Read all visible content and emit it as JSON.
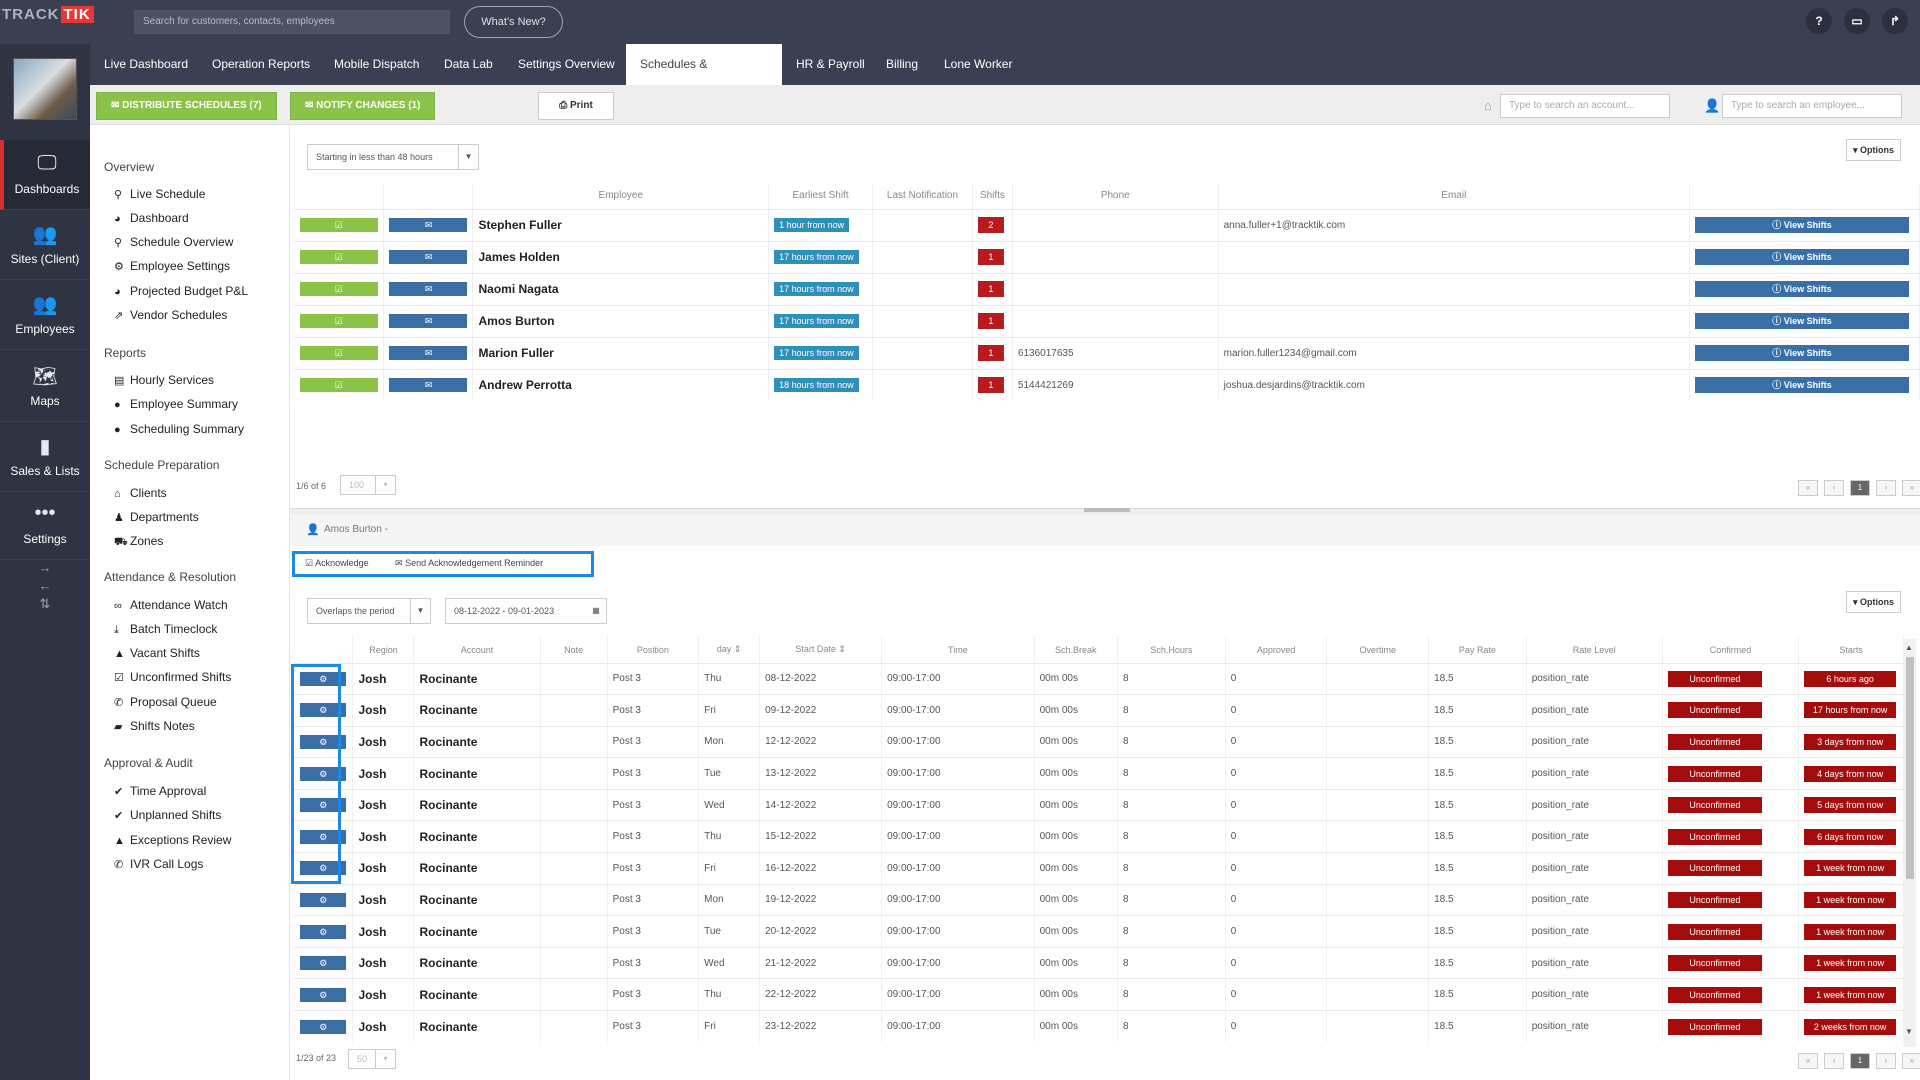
{
  "topbar": {
    "logo_a": "TRACK",
    "logo_b": "TIK",
    "search_placeholder": "Search for customers, contacts, employees",
    "whats_new": "What's New?"
  },
  "nav_tabs": [
    "Live Dashboard",
    "Operation Reports",
    "Mobile Dispatch",
    "Data Lab",
    "Settings Overview",
    "Schedules & Attendance",
    "HR & Payroll",
    "Billing",
    "Lone Worker"
  ],
  "left_nav": [
    "Dashboards",
    "Sites (Client)",
    "Employees",
    "Maps",
    "Sales & Lists",
    "Settings"
  ],
  "toolbar": {
    "distribute": "DISTRIBUTE SCHEDULES (7)",
    "notify": "NOTIFY CHANGES (1)",
    "print": "Print",
    "account_search": "Type to search an account...",
    "employee_search": "Type to search an employee..."
  },
  "sidemenu": {
    "sections": [
      {
        "title": "Overview",
        "items": [
          "Live Schedule",
          "Dashboard",
          "Schedule Overview",
          "Employee Settings",
          "Projected Budget P&L",
          "Vendor Schedules"
        ]
      },
      {
        "title": "Reports",
        "items": [
          "Hourly Services",
          "Employee Summary",
          "Scheduling Summary"
        ]
      },
      {
        "title": "Schedule Preparation",
        "items": [
          "Clients",
          "Departments",
          "Zones"
        ]
      },
      {
        "title": "Attendance & Resolution",
        "items": [
          "Attendance Watch",
          "Batch Timeclock",
          "Vacant Shifts",
          "Unconfirmed Shifts",
          "Proposal Queue",
          "Shifts Notes"
        ]
      },
      {
        "title": "Approval & Audit",
        "items": [
          "Time Approval",
          "Unplanned Shifts",
          "Exceptions Review",
          "IVR Call Logs"
        ]
      }
    ]
  },
  "top_panel": {
    "filter": "Starting in less than 48 hours",
    "options": "Options",
    "headers": [
      "Employee",
      "Earliest Shift",
      "Last Notification",
      "Shifts",
      "Phone",
      "Email"
    ],
    "rows": [
      {
        "employee": "Stephen Fuller",
        "earliest": "1 hour from now",
        "shifts": "2",
        "phone": "",
        "email": "anna.fuller+1@tracktik.com"
      },
      {
        "employee": "James Holden",
        "earliest": "17 hours from now",
        "shifts": "1",
        "phone": "",
        "email": ""
      },
      {
        "employee": "Naomi Nagata",
        "earliest": "17 hours from now",
        "shifts": "1",
        "phone": "",
        "email": ""
      },
      {
        "employee": "Amos Burton",
        "earliest": "17 hours from now",
        "shifts": "1",
        "phone": "",
        "email": ""
      },
      {
        "employee": "Marion Fuller",
        "earliest": "17 hours from now",
        "shifts": "1",
        "phone": "6136017635",
        "email": "marion.fuller1234@gmail.com"
      },
      {
        "employee": "Andrew Perrotta",
        "earliest": "18 hours from now",
        "shifts": "1",
        "phone": "5144421269",
        "email": "joshua.desjardins@tracktik.com"
      }
    ],
    "view_shifts": "View Shifts",
    "pager": "1/6 of 6",
    "page_size": "100",
    "page": "1"
  },
  "bottom_panel": {
    "employee_label": "Amos Burton -",
    "acknowledge": "Acknowledge",
    "send_reminder": "Send Acknowledgement Reminder",
    "period_filter": "Overlaps the period",
    "date_range": "08-12-2022 - 09-01-2023",
    "options": "Options",
    "headers": [
      "Region",
      "Account",
      "Note",
      "Position",
      "day",
      "Start Date",
      "Time",
      "Sch.Break",
      "Sch.Hours",
      "Approved",
      "Overtime",
      "Pay Rate",
      "Rate Level",
      "Confirmed",
      "Starts"
    ],
    "rows": [
      {
        "region": "Josh",
        "account": "Rocinante",
        "position": "Post 3",
        "day": "Thu",
        "date": "08-12-2022",
        "time": "09:00-17:00",
        "brk": "00m 00s",
        "hours": "8",
        "approved": "0",
        "pay": "18.5",
        "rate": "position_rate",
        "confirmed": "Unconfirmed",
        "starts": "6 hours ago"
      },
      {
        "region": "Josh",
        "account": "Rocinante",
        "position": "Post 3",
        "day": "Fri",
        "date": "09-12-2022",
        "time": "09:00-17:00",
        "brk": "00m 00s",
        "hours": "8",
        "approved": "0",
        "pay": "18.5",
        "rate": "position_rate",
        "confirmed": "Unconfirmed",
        "starts": "17 hours from now"
      },
      {
        "region": "Josh",
        "account": "Rocinante",
        "position": "Post 3",
        "day": "Mon",
        "date": "12-12-2022",
        "time": "09:00-17:00",
        "brk": "00m 00s",
        "hours": "8",
        "approved": "0",
        "pay": "18.5",
        "rate": "position_rate",
        "confirmed": "Unconfirmed",
        "starts": "3 days from now"
      },
      {
        "region": "Josh",
        "account": "Rocinante",
        "position": "Post 3",
        "day": "Tue",
        "date": "13-12-2022",
        "time": "09:00-17:00",
        "brk": "00m 00s",
        "hours": "8",
        "approved": "0",
        "pay": "18.5",
        "rate": "position_rate",
        "confirmed": "Unconfirmed",
        "starts": "4 days from now"
      },
      {
        "region": "Josh",
        "account": "Rocinante",
        "position": "Post 3",
        "day": "Wed",
        "date": "14-12-2022",
        "time": "09:00-17:00",
        "brk": "00m 00s",
        "hours": "8",
        "approved": "0",
        "pay": "18.5",
        "rate": "position_rate",
        "confirmed": "Unconfirmed",
        "starts": "5 days from now"
      },
      {
        "region": "Josh",
        "account": "Rocinante",
        "position": "Post 3",
        "day": "Thu",
        "date": "15-12-2022",
        "time": "09:00-17:00",
        "brk": "00m 00s",
        "hours": "8",
        "approved": "0",
        "pay": "18.5",
        "rate": "position_rate",
        "confirmed": "Unconfirmed",
        "starts": "6 days from now"
      },
      {
        "region": "Josh",
        "account": "Rocinante",
        "position": "Post 3",
        "day": "Fri",
        "date": "16-12-2022",
        "time": "09:00-17:00",
        "brk": "00m 00s",
        "hours": "8",
        "approved": "0",
        "pay": "18.5",
        "rate": "position_rate",
        "confirmed": "Unconfirmed",
        "starts": "1 week from now"
      },
      {
        "region": "Josh",
        "account": "Rocinante",
        "position": "Post 3",
        "day": "Mon",
        "date": "19-12-2022",
        "time": "09:00-17:00",
        "brk": "00m 00s",
        "hours": "8",
        "approved": "0",
        "pay": "18.5",
        "rate": "position_rate",
        "confirmed": "Unconfirmed",
        "starts": "1 week from now"
      },
      {
        "region": "Josh",
        "account": "Rocinante",
        "position": "Post 3",
        "day": "Tue",
        "date": "20-12-2022",
        "time": "09:00-17:00",
        "brk": "00m 00s",
        "hours": "8",
        "approved": "0",
        "pay": "18.5",
        "rate": "position_rate",
        "confirmed": "Unconfirmed",
        "starts": "1 week from now"
      },
      {
        "region": "Josh",
        "account": "Rocinante",
        "position": "Post 3",
        "day": "Wed",
        "date": "21-12-2022",
        "time": "09:00-17:00",
        "brk": "00m 00s",
        "hours": "8",
        "approved": "0",
        "pay": "18.5",
        "rate": "position_rate",
        "confirmed": "Unconfirmed",
        "starts": "1 week from now"
      },
      {
        "region": "Josh",
        "account": "Rocinante",
        "position": "Post 3",
        "day": "Thu",
        "date": "22-12-2022",
        "time": "09:00-17:00",
        "brk": "00m 00s",
        "hours": "8",
        "approved": "0",
        "pay": "18.5",
        "rate": "position_rate",
        "confirmed": "Unconfirmed",
        "starts": "1 week from now"
      },
      {
        "region": "Josh",
        "account": "Rocinante",
        "position": "Post 3",
        "day": "Fri",
        "date": "23-12-2022",
        "time": "09:00-17:00",
        "brk": "00m 00s",
        "hours": "8",
        "approved": "0",
        "pay": "18.5",
        "rate": "position_rate",
        "confirmed": "Unconfirmed",
        "starts": "2 weeks from now"
      }
    ],
    "pager": "1/23 of 23",
    "page_size": "50",
    "page": "1"
  }
}
